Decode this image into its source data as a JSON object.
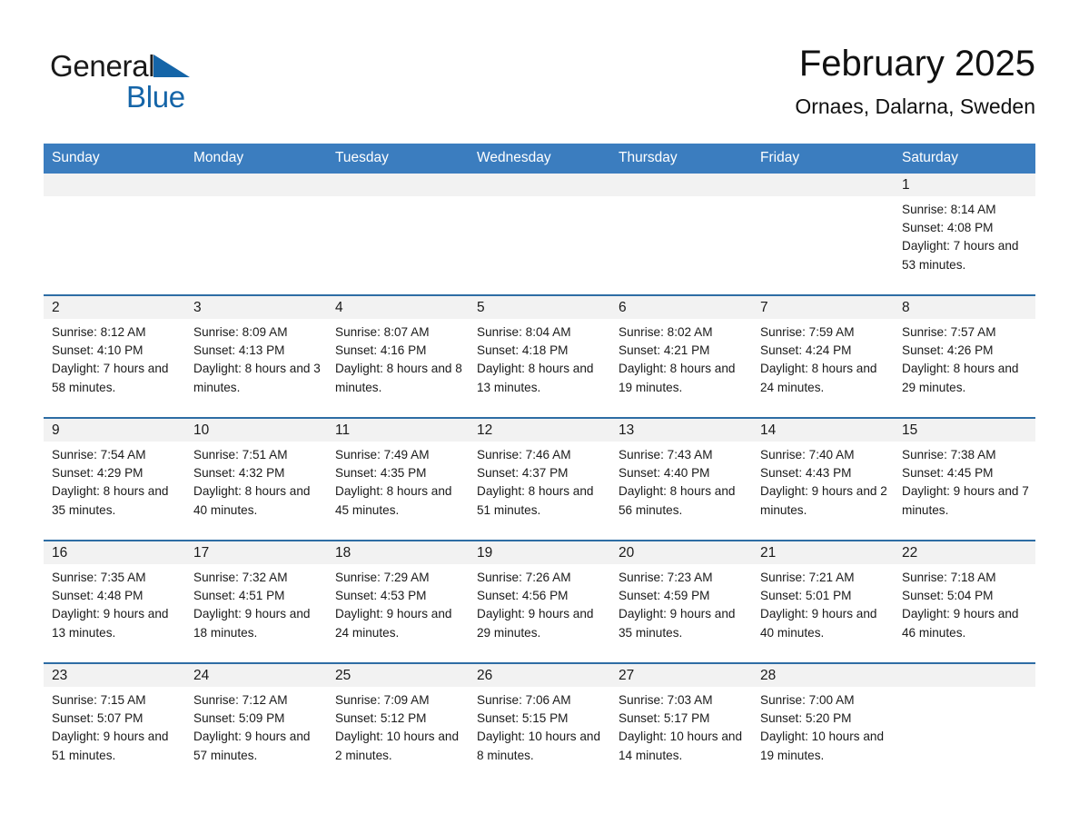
{
  "brand": {
    "name_part1": "General",
    "name_part2": "Blue",
    "logo_icon": "triangle-flag-icon",
    "accent_color": "#1565a8"
  },
  "header": {
    "title": "February 2025",
    "subtitle": "Ornaes, Dalarna, Sweden"
  },
  "theme": {
    "header_row_bg": "#3b7dbf",
    "row_divider": "#2e6da4",
    "daynum_bg": "#f2f2f2"
  },
  "calendar": {
    "weekday_headers": [
      "Sunday",
      "Monday",
      "Tuesday",
      "Wednesday",
      "Thursday",
      "Friday",
      "Saturday"
    ],
    "weeks": [
      [
        {
          "day": "",
          "blank": true
        },
        {
          "day": "",
          "blank": true
        },
        {
          "day": "",
          "blank": true
        },
        {
          "day": "",
          "blank": true
        },
        {
          "day": "",
          "blank": true
        },
        {
          "day": "",
          "blank": true
        },
        {
          "day": "1",
          "sunrise": "Sunrise: 8:14 AM",
          "sunset": "Sunset: 4:08 PM",
          "daylight": "Daylight: 7 hours and 53 minutes."
        }
      ],
      [
        {
          "day": "2",
          "sunrise": "Sunrise: 8:12 AM",
          "sunset": "Sunset: 4:10 PM",
          "daylight": "Daylight: 7 hours and 58 minutes."
        },
        {
          "day": "3",
          "sunrise": "Sunrise: 8:09 AM",
          "sunset": "Sunset: 4:13 PM",
          "daylight": "Daylight: 8 hours and 3 minutes."
        },
        {
          "day": "4",
          "sunrise": "Sunrise: 8:07 AM",
          "sunset": "Sunset: 4:16 PM",
          "daylight": "Daylight: 8 hours and 8 minutes."
        },
        {
          "day": "5",
          "sunrise": "Sunrise: 8:04 AM",
          "sunset": "Sunset: 4:18 PM",
          "daylight": "Daylight: 8 hours and 13 minutes."
        },
        {
          "day": "6",
          "sunrise": "Sunrise: 8:02 AM",
          "sunset": "Sunset: 4:21 PM",
          "daylight": "Daylight: 8 hours and 19 minutes."
        },
        {
          "day": "7",
          "sunrise": "Sunrise: 7:59 AM",
          "sunset": "Sunset: 4:24 PM",
          "daylight": "Daylight: 8 hours and 24 minutes."
        },
        {
          "day": "8",
          "sunrise": "Sunrise: 7:57 AM",
          "sunset": "Sunset: 4:26 PM",
          "daylight": "Daylight: 8 hours and 29 minutes."
        }
      ],
      [
        {
          "day": "9",
          "sunrise": "Sunrise: 7:54 AM",
          "sunset": "Sunset: 4:29 PM",
          "daylight": "Daylight: 8 hours and 35 minutes."
        },
        {
          "day": "10",
          "sunrise": "Sunrise: 7:51 AM",
          "sunset": "Sunset: 4:32 PM",
          "daylight": "Daylight: 8 hours and 40 minutes."
        },
        {
          "day": "11",
          "sunrise": "Sunrise: 7:49 AM",
          "sunset": "Sunset: 4:35 PM",
          "daylight": "Daylight: 8 hours and 45 minutes."
        },
        {
          "day": "12",
          "sunrise": "Sunrise: 7:46 AM",
          "sunset": "Sunset: 4:37 PM",
          "daylight": "Daylight: 8 hours and 51 minutes."
        },
        {
          "day": "13",
          "sunrise": "Sunrise: 7:43 AM",
          "sunset": "Sunset: 4:40 PM",
          "daylight": "Daylight: 8 hours and 56 minutes."
        },
        {
          "day": "14",
          "sunrise": "Sunrise: 7:40 AM",
          "sunset": "Sunset: 4:43 PM",
          "daylight": "Daylight: 9 hours and 2 minutes."
        },
        {
          "day": "15",
          "sunrise": "Sunrise: 7:38 AM",
          "sunset": "Sunset: 4:45 PM",
          "daylight": "Daylight: 9 hours and 7 minutes."
        }
      ],
      [
        {
          "day": "16",
          "sunrise": "Sunrise: 7:35 AM",
          "sunset": "Sunset: 4:48 PM",
          "daylight": "Daylight: 9 hours and 13 minutes."
        },
        {
          "day": "17",
          "sunrise": "Sunrise: 7:32 AM",
          "sunset": "Sunset: 4:51 PM",
          "daylight": "Daylight: 9 hours and 18 minutes."
        },
        {
          "day": "18",
          "sunrise": "Sunrise: 7:29 AM",
          "sunset": "Sunset: 4:53 PM",
          "daylight": "Daylight: 9 hours and 24 minutes."
        },
        {
          "day": "19",
          "sunrise": "Sunrise: 7:26 AM",
          "sunset": "Sunset: 4:56 PM",
          "daylight": "Daylight: 9 hours and 29 minutes."
        },
        {
          "day": "20",
          "sunrise": "Sunrise: 7:23 AM",
          "sunset": "Sunset: 4:59 PM",
          "daylight": "Daylight: 9 hours and 35 minutes."
        },
        {
          "day": "21",
          "sunrise": "Sunrise: 7:21 AM",
          "sunset": "Sunset: 5:01 PM",
          "daylight": "Daylight: 9 hours and 40 minutes."
        },
        {
          "day": "22",
          "sunrise": "Sunrise: 7:18 AM",
          "sunset": "Sunset: 5:04 PM",
          "daylight": "Daylight: 9 hours and 46 minutes."
        }
      ],
      [
        {
          "day": "23",
          "sunrise": "Sunrise: 7:15 AM",
          "sunset": "Sunset: 5:07 PM",
          "daylight": "Daylight: 9 hours and 51 minutes."
        },
        {
          "day": "24",
          "sunrise": "Sunrise: 7:12 AM",
          "sunset": "Sunset: 5:09 PM",
          "daylight": "Daylight: 9 hours and 57 minutes."
        },
        {
          "day": "25",
          "sunrise": "Sunrise: 7:09 AM",
          "sunset": "Sunset: 5:12 PM",
          "daylight": "Daylight: 10 hours and 2 minutes."
        },
        {
          "day": "26",
          "sunrise": "Sunrise: 7:06 AM",
          "sunset": "Sunset: 5:15 PM",
          "daylight": "Daylight: 10 hours and 8 minutes."
        },
        {
          "day": "27",
          "sunrise": "Sunrise: 7:03 AM",
          "sunset": "Sunset: 5:17 PM",
          "daylight": "Daylight: 10 hours and 14 minutes."
        },
        {
          "day": "28",
          "sunrise": "Sunrise: 7:00 AM",
          "sunset": "Sunset: 5:20 PM",
          "daylight": "Daylight: 10 hours and 19 minutes."
        },
        {
          "day": "",
          "blank": true
        }
      ]
    ]
  }
}
